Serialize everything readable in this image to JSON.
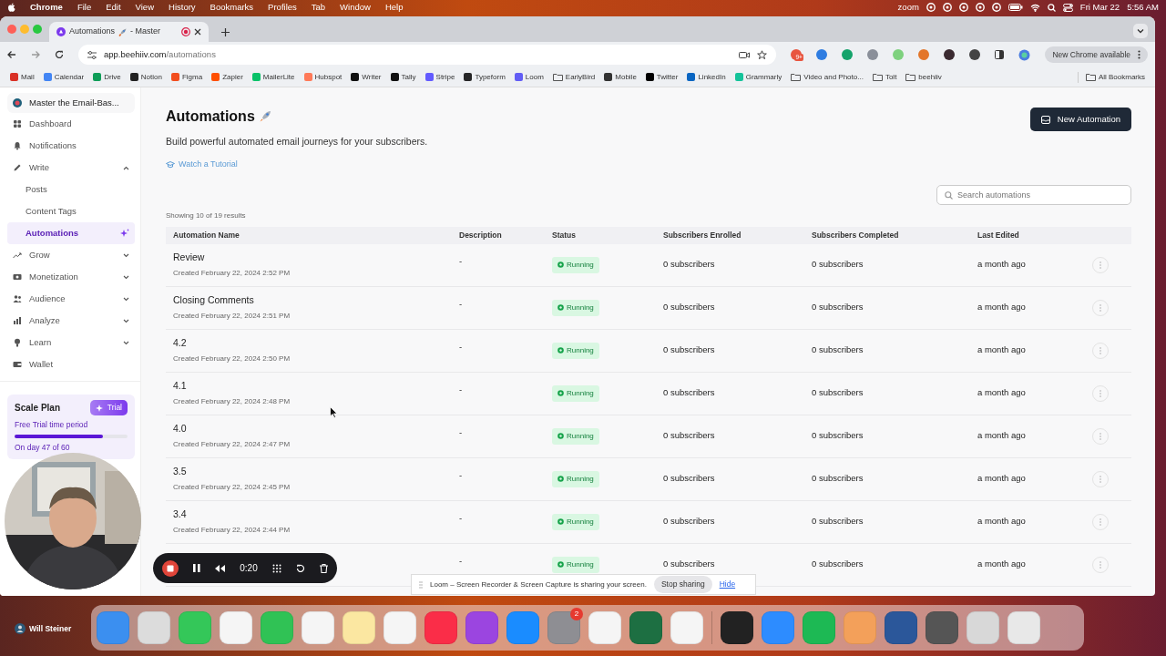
{
  "menubar": {
    "app": "Chrome",
    "menus": [
      "File",
      "Edit",
      "View",
      "History",
      "Bookmarks",
      "Profiles",
      "Tab",
      "Window",
      "Help"
    ],
    "zoom_label": "zoom",
    "date": "Fri Mar 22",
    "time": "5:56 AM"
  },
  "browser": {
    "tab": {
      "title": "Automations",
      "title_suffix": "- Master",
      "recording": true
    },
    "url_host": "app.beehiiv.com",
    "url_path": "/automations",
    "extensions": [
      {
        "color": "#e8553f",
        "badge": "9+"
      },
      {
        "color": "#2f7de1"
      },
      {
        "color": "#15a36b"
      },
      {
        "color": "#8a8f99"
      },
      {
        "color": "#7ed17e"
      },
      {
        "color": "#e3762a"
      },
      {
        "color": "#3a2a30"
      },
      {
        "color": "#444444"
      }
    ],
    "update_button": "New Chrome available",
    "bookmarks": [
      {
        "label": "Mail",
        "kind": "site",
        "color": "#d93025"
      },
      {
        "label": "Calendar",
        "kind": "site",
        "color": "#4285f4"
      },
      {
        "label": "Drive",
        "kind": "site",
        "color": "#0f9d58"
      },
      {
        "label": "Notion",
        "kind": "site",
        "color": "#222222"
      },
      {
        "label": "Figma",
        "kind": "site",
        "color": "#f24e1e"
      },
      {
        "label": "Zapier",
        "kind": "site",
        "color": "#ff4f00"
      },
      {
        "label": "MailerLite",
        "kind": "site",
        "color": "#09c269"
      },
      {
        "label": "Hubspot",
        "kind": "site",
        "color": "#ff7a59"
      },
      {
        "label": "Writer",
        "kind": "site",
        "color": "#111111"
      },
      {
        "label": "Tally",
        "kind": "site",
        "color": "#111111"
      },
      {
        "label": "Stripe",
        "kind": "site",
        "color": "#635bff"
      },
      {
        "label": "Typeform",
        "kind": "site",
        "color": "#262627"
      },
      {
        "label": "Loom",
        "kind": "site",
        "color": "#625df5"
      },
      {
        "label": "EarlyBird",
        "kind": "folder"
      },
      {
        "label": "Mobile",
        "kind": "site",
        "color": "#333333"
      },
      {
        "label": "Twitter",
        "kind": "site",
        "color": "#000000"
      },
      {
        "label": "LinkedIn",
        "kind": "site",
        "color": "#0a66c2"
      },
      {
        "label": "Grammarly",
        "kind": "site",
        "color": "#15c39a"
      },
      {
        "label": "Video and Photo...",
        "kind": "folder"
      },
      {
        "label": "Tolt",
        "kind": "folder"
      },
      {
        "label": "beehiiv",
        "kind": "folder"
      },
      {
        "label": "All Bookmarks",
        "kind": "folder"
      }
    ]
  },
  "sidebar": {
    "publication": "Master the Email-Bas...",
    "items": [
      {
        "label": "Dashboard",
        "selected": false
      },
      {
        "label": "Notifications",
        "selected": false
      },
      {
        "label": "Write",
        "selected": false,
        "expanded": true,
        "children": [
          {
            "label": "Posts",
            "selected": false
          },
          {
            "label": "Content Tags",
            "selected": false
          },
          {
            "label": "Automations",
            "selected": true
          }
        ]
      },
      {
        "label": "Grow",
        "selected": false,
        "expanded": false
      },
      {
        "label": "Monetization",
        "selected": false,
        "expanded": false
      },
      {
        "label": "Audience",
        "selected": false,
        "expanded": false
      },
      {
        "label": "Analyze",
        "selected": false,
        "expanded": false
      },
      {
        "label": "Learn",
        "selected": false,
        "expanded": false
      },
      {
        "label": "Wallet",
        "selected": false
      }
    ],
    "plan": {
      "name": "Scale Plan",
      "badge": "Trial",
      "period": "Free Trial time period",
      "level": 0.783,
      "progress_text": "On day 47 of 60"
    }
  },
  "page": {
    "title": "Automations",
    "subtitle": "Build powerful automated email journeys for your subscribers.",
    "tutorial_link": "Watch a Tutorial",
    "new_button": "New Automation",
    "search": {
      "placeholder": "Search automations"
    },
    "results": "Showing 10 of 19 results"
  },
  "table": {
    "columns": [
      "Automation Name",
      "Description",
      "Status",
      "Subscribers Enrolled",
      "Subscribers Completed",
      "Last Edited"
    ],
    "rows": [
      {
        "name": "Review",
        "created": "Created February 22, 2024 2:52 PM",
        "description": "-",
        "status": "Running",
        "enrolled": "0 subscribers",
        "completed": "0 subscribers",
        "edited": "a month ago"
      },
      {
        "name": "Closing Comments",
        "created": "Created February 22, 2024 2:51 PM",
        "description": "-",
        "status": "Running",
        "enrolled": "0 subscribers",
        "completed": "0 subscribers",
        "edited": "a month ago"
      },
      {
        "name": "4.2",
        "created": "Created February 22, 2024 2:50 PM",
        "description": "-",
        "status": "Running",
        "enrolled": "0 subscribers",
        "completed": "0 subscribers",
        "edited": "a month ago"
      },
      {
        "name": "4.1",
        "created": "Created February 22, 2024 2:48 PM",
        "description": "-",
        "status": "Running",
        "enrolled": "0 subscribers",
        "completed": "0 subscribers",
        "edited": "a month ago"
      },
      {
        "name": "4.0",
        "created": "Created February 22, 2024 2:47 PM",
        "description": "-",
        "status": "Running",
        "enrolled": "0 subscribers",
        "completed": "0 subscribers",
        "edited": "a month ago"
      },
      {
        "name": "3.5",
        "created": "Created February 22, 2024 2:45 PM",
        "description": "-",
        "status": "Running",
        "enrolled": "0 subscribers",
        "completed": "0 subscribers",
        "edited": "a month ago"
      },
      {
        "name": "3.4",
        "created": "Created February 22, 2024 2:44 PM",
        "description": "-",
        "status": "Running",
        "enrolled": "0 subscribers",
        "completed": "0 subscribers",
        "edited": "a month ago"
      },
      {
        "description": "-",
        "status": "Running",
        "enrolled": "0 subscribers",
        "completed": "0 subscribers",
        "edited": "a month ago"
      }
    ]
  },
  "recorder": {
    "elapsed": "0:20"
  },
  "share_banner": {
    "message": "Loom – Screen Recorder & Screen Capture is sharing your screen.",
    "stop_button": "Stop sharing",
    "hide_link": "Hide"
  },
  "desktop": {
    "user": "Will Steiner"
  },
  "dock": [
    {
      "color": "#3b8ff0"
    },
    {
      "color": "#dcdcdc"
    },
    {
      "color": "#34c759"
    },
    {
      "color": "#f5f5f5"
    },
    {
      "color": "#30c255"
    },
    {
      "color": "#f5f5f5"
    },
    {
      "color": "#fbe7a1"
    },
    {
      "color": "#f5f5f5"
    },
    {
      "color": "#fa2d48"
    },
    {
      "color": "#9b45e0"
    },
    {
      "color": "#1a8cff"
    },
    {
      "color": "#8e8e93",
      "badge": "2"
    },
    {
      "color": "#f5f5f5"
    },
    {
      "color": "#1d6f42"
    },
    {
      "color": "#f5f5f5"
    },
    {
      "color": "#222222"
    },
    {
      "color": "#2d8cff"
    },
    {
      "color": "#1db954"
    },
    {
      "color": "#f3a05a"
    },
    {
      "color": "#2b579a"
    },
    {
      "color": "#555555"
    },
    {
      "color": "#d8d8d8"
    },
    {
      "color": "#e8e8e8"
    }
  ]
}
